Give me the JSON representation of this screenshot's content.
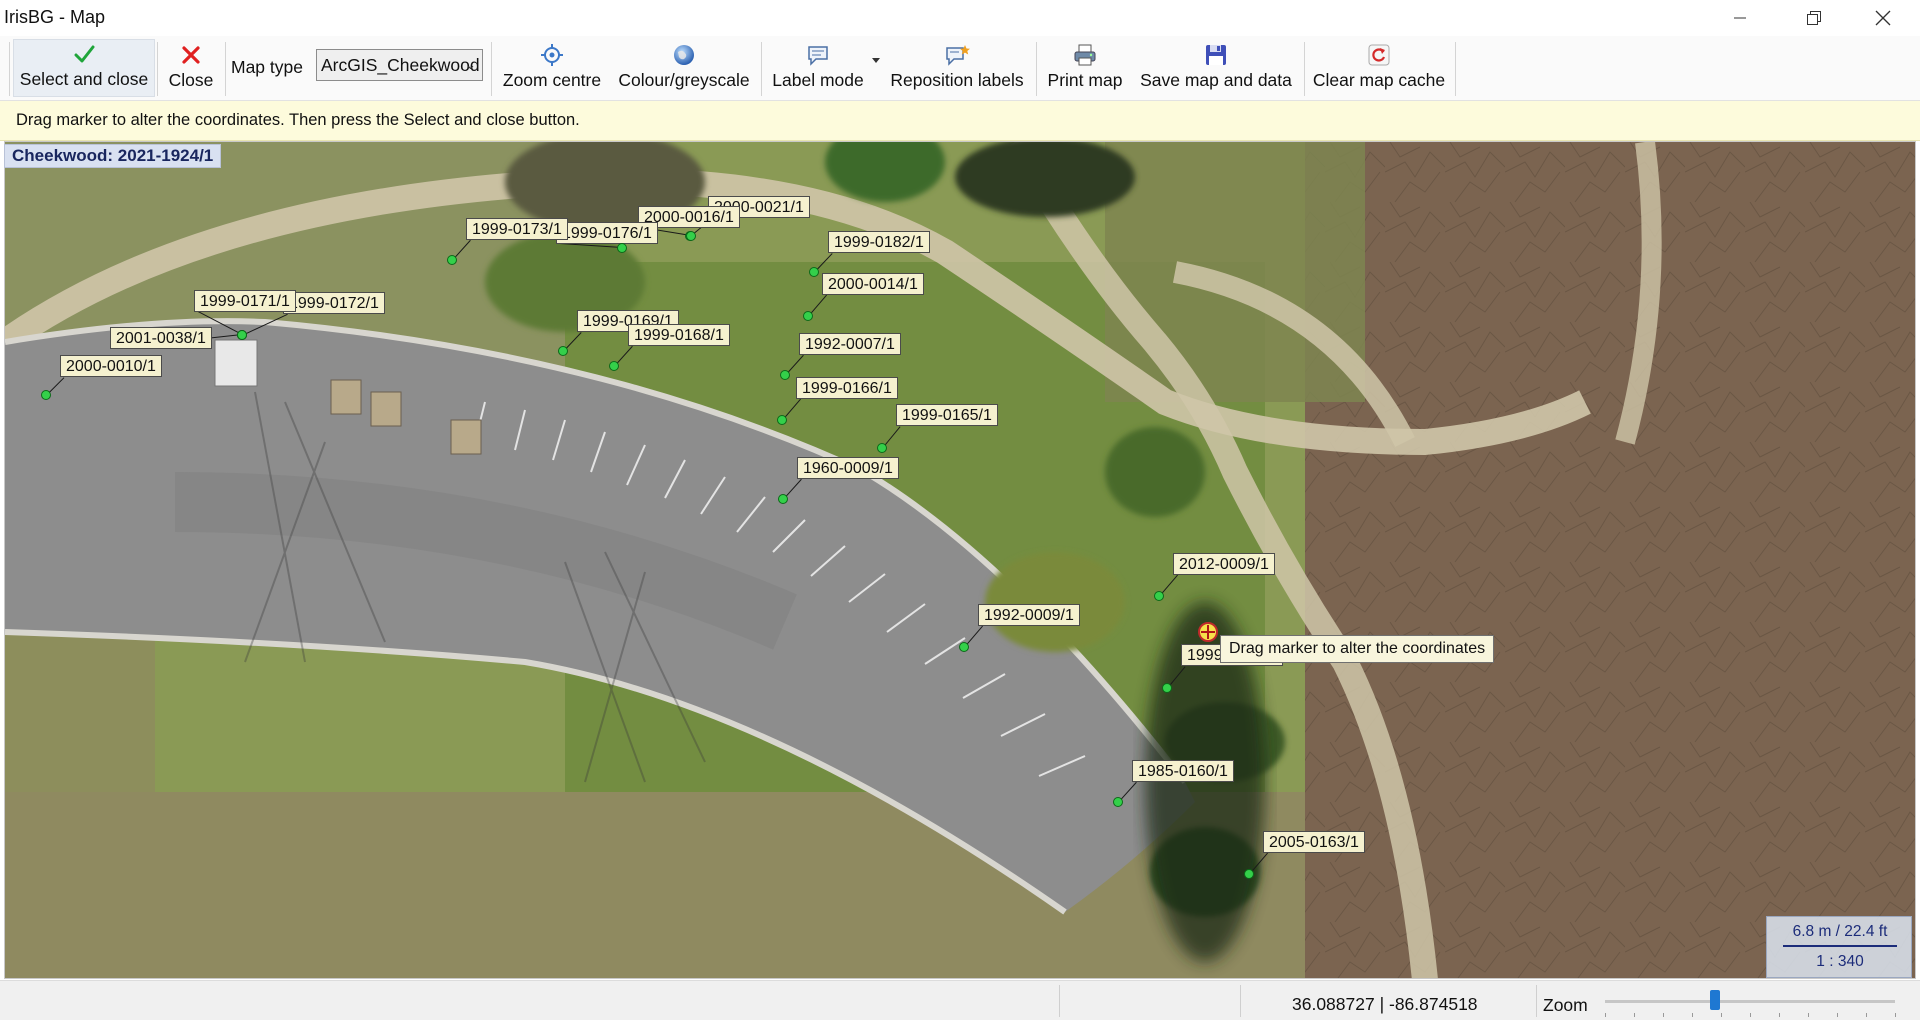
{
  "window": {
    "title": "IrisBG - Map",
    "minimize_icon": "minimize-icon",
    "restore_icon": "restore-icon",
    "close_icon": "close-icon"
  },
  "toolbar": {
    "select_close_label": "Select and close",
    "close_label": "Close",
    "map_type_label": "Map type",
    "map_type_value": "ArcGIS_Cheekwood",
    "zoom_centre_label": "Zoom centre",
    "colour_label": "Colour/greyscale",
    "label_mode_label": "Label mode",
    "reposition_label": "Reposition labels",
    "print_label": "Print map",
    "save_label": "Save map and data",
    "clear_cache_label": "Clear map cache"
  },
  "hint": {
    "text": "Drag marker to alter the coordinates. Then press the Select and close button."
  },
  "map": {
    "garden_title": "Cheekwood: 2021-1924/1",
    "tooltip": "Drag marker to alter the coordinates",
    "labels": [
      "2000-0021/1",
      "2000-0016/1",
      "1999-0176/1",
      "1999-0173/1",
      "1999-0182/1",
      "2000-0014/1",
      "1999-0172/1",
      "1999-0171/1",
      "2001-0038/1",
      "1999-0169/1",
      "1999-0168/1",
      "2000-0010/1",
      "1992-0007/1",
      "1999-0166/1",
      "1999-0165/1",
      "1960-0009/1",
      "2012-0009/1",
      "1992-0009/1",
      "1999-0170/1",
      "1985-0160/1",
      "2005-0163/1"
    ]
  },
  "scale": {
    "distance": "6.8 m / 22.4 ft",
    "ratio": "1 : 340"
  },
  "status": {
    "coordinates": "36.088727 | -86.874518",
    "zoom_label": "Zoom",
    "zoom_level": 0.38
  },
  "colors": {
    "hint_bg": "#fdfbdc",
    "label_bg": "#f5f1cf",
    "marker": "#34d04a",
    "title_bg": "#d9e1f1",
    "accent": "#1e78d2"
  }
}
